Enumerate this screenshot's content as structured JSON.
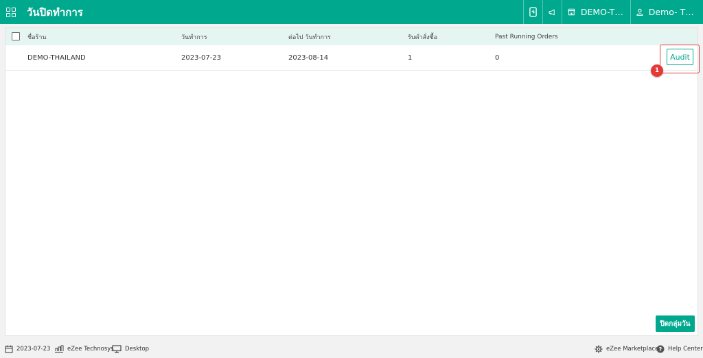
{
  "header": {
    "title": "วันปิดทำการ",
    "store_label": "DEMO-THAI...",
    "user_label": "Demo- Thail...",
    "icons": [
      "apps-grid-icon",
      "mobile-device-icon",
      "megaphone-icon",
      "store-icon",
      "user-icon"
    ]
  },
  "table": {
    "columns": [
      "ชื่อร้าน",
      "วันทำการ",
      "ต่อไป วันทำการ",
      "รับคำสั่งซื้อ",
      "Past Running Orders"
    ],
    "rows": [
      {
        "store": "DEMO-THAILAND",
        "business_date": "2023-07-23",
        "next_business_date": "2023-08-14",
        "orders": "1",
        "past_running_orders": "0",
        "action": "Audit"
      }
    ]
  },
  "annotation": {
    "badge": "1",
    "highlight_color": "#e53935"
  },
  "close_day_button": "ปิดกลุ่มวัน",
  "footer": {
    "date": "2023-07-23",
    "company": "eZee Technosys",
    "device": "Desktop",
    "marketplace": "eZee Marketplace",
    "help": "Help Center"
  },
  "colors": {
    "brand": "#00a88e",
    "header_row_bg": "#e4f5f2",
    "annotation": "#e53935"
  }
}
